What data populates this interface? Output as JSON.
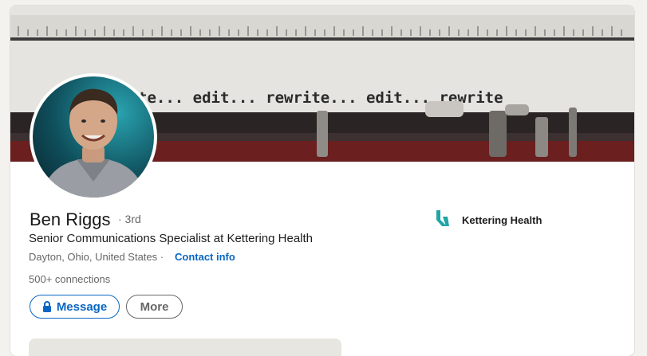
{
  "profile": {
    "name": "Ben Riggs",
    "degree": "· 3rd",
    "headline": "Senior Communications Specialist at Kettering Health",
    "location": "Dayton, Ohio, United States",
    "location_separator": "·",
    "contact_label": "Contact info",
    "connections": "500+ connections"
  },
  "banner": {
    "typed_text": "te... edit... rewrite... edit... rewrite"
  },
  "actions": {
    "message_label": "Message",
    "more_label": "More"
  },
  "company": {
    "name": "Kettering Health",
    "logo_color": "#1fa5a7"
  },
  "colors": {
    "accent": "#0a66c2",
    "background": "#f4f2ee"
  }
}
